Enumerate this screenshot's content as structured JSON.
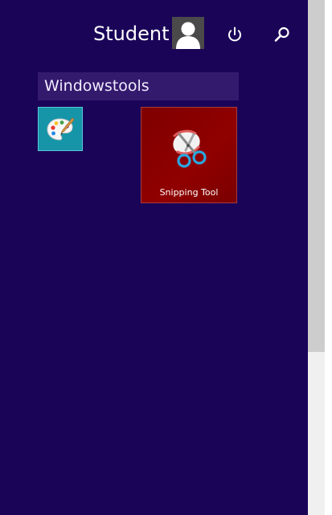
{
  "header": {
    "user_name": "Student",
    "avatar_icon": "user-silhouette-icon",
    "power_icon": "power-icon",
    "search_icon": "search-icon"
  },
  "groups": [
    {
      "label": "Windowstools",
      "tiles": [
        {
          "label": "",
          "icon": "paint-palette-icon",
          "color": "#1795a8"
        },
        {
          "label": "Snipping Tool",
          "icon": "scissors-icon",
          "color": "#8b0000"
        }
      ]
    }
  ],
  "colors": {
    "background": "#1a0458",
    "group_header": "#341a6d",
    "scrollbar_track": "#f0f0f0",
    "scrollbar_thumb": "#cdcdcd"
  },
  "scrollbar": {
    "visible_fraction": 0.68
  }
}
